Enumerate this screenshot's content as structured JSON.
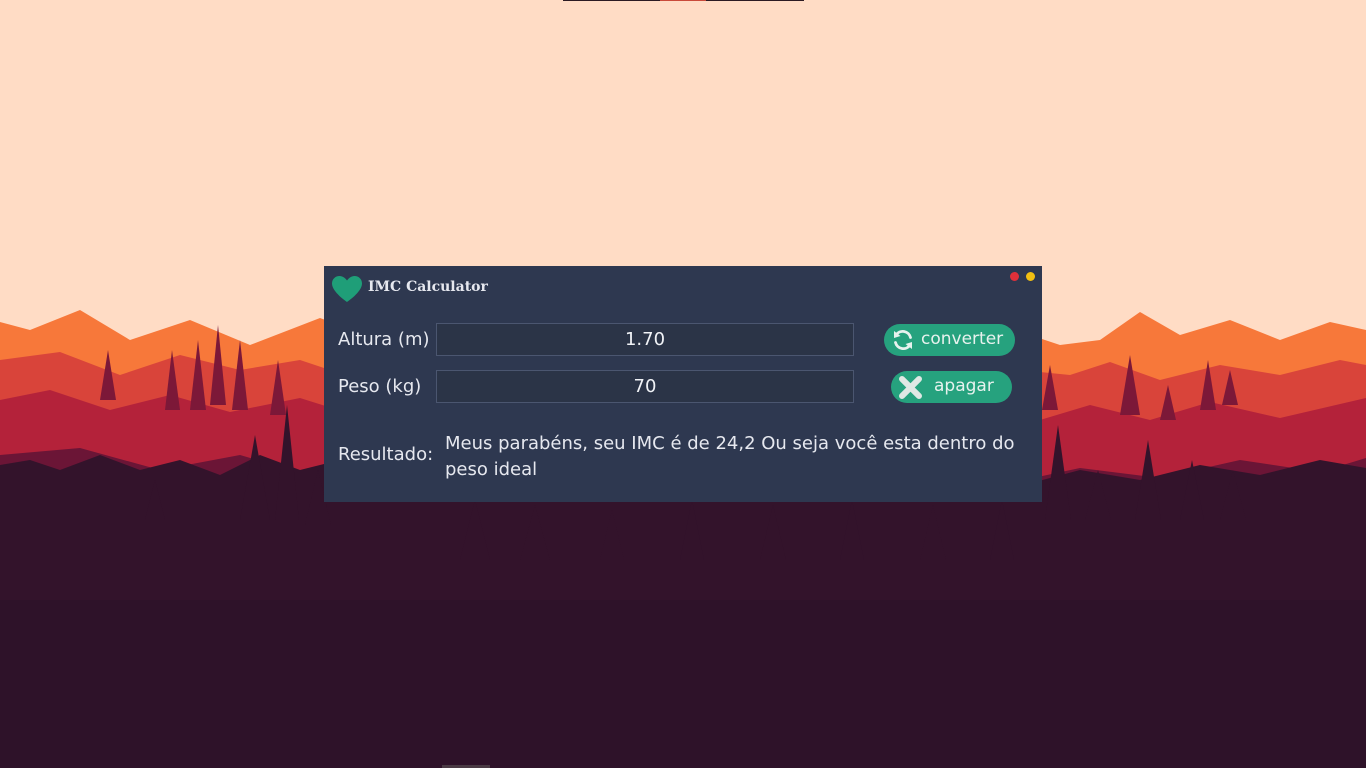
{
  "window": {
    "title": "IMC Calculator",
    "icon": "heart-icon"
  },
  "form": {
    "altura_label": "Altura (m)",
    "altura_value": "1.70",
    "peso_label": "Peso (kg)",
    "peso_value": "70"
  },
  "buttons": {
    "convert_label": "converter",
    "convert_icon": "refresh-icon",
    "clear_label": "apagar",
    "clear_icon": "close-icon"
  },
  "result": {
    "label": "Resultado:",
    "text": "Meus parabéns, seu IMC é de 24,2 Ou seja você esta dentro do peso ideal"
  },
  "colors": {
    "window_bg": "#2e3850",
    "accent": "#26a27e",
    "close_dot": "#e0303a",
    "minimize_dot": "#f2bf12",
    "sky": "#ffdcc5"
  }
}
